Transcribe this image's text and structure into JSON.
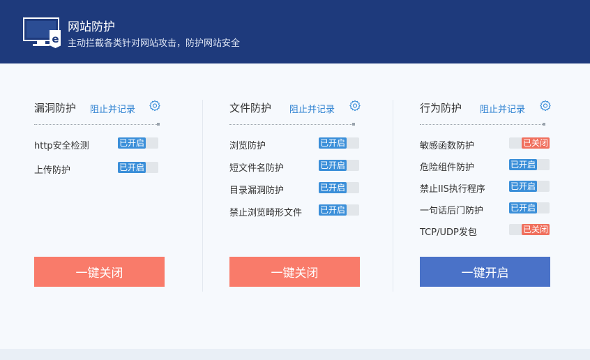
{
  "header": {
    "title": "网站防护",
    "subtitle": "主动拦截各类针对网站攻击，防护网站安全",
    "monitor_badge": "e"
  },
  "colors": {
    "header_bg": "#1e3a7c",
    "on": "#3b8fd9",
    "off": "#f0705e",
    "close_button": "#f97b6a",
    "open_button": "#4a72c8",
    "link": "#2a7fd0"
  },
  "columns": [
    {
      "title": "漏洞防护",
      "action": "阻止并记录",
      "icon": "gear-icon",
      "items": [
        {
          "label": "http安全检测",
          "status": "已开启",
          "state": "on"
        },
        {
          "label": "上传防护",
          "status": "已开启",
          "state": "on"
        }
      ],
      "button": "一键关闭"
    },
    {
      "title": "文件防护",
      "action": "阻止并记录",
      "icon": "gear-icon",
      "items": [
        {
          "label": "浏览防护",
          "status": "已开启",
          "state": "on"
        },
        {
          "label": "短文件名防护",
          "status": "已开启",
          "state": "on"
        },
        {
          "label": "目录漏洞防护",
          "status": "已开启",
          "state": "on"
        },
        {
          "label": "禁止浏览畸形文件",
          "status": "已开启",
          "state": "on"
        }
      ],
      "button": "一键关闭"
    },
    {
      "title": "行为防护",
      "action": "阻止并记录",
      "icon": "gear-icon",
      "items": [
        {
          "label": "敏感函数防护",
          "status": "已关闭",
          "state": "off"
        },
        {
          "label": "危险组件防护",
          "status": "已开启",
          "state": "on"
        },
        {
          "label": "禁止IIS执行程序",
          "status": "已开启",
          "state": "on"
        },
        {
          "label": "一句话后门防护",
          "status": "已开启",
          "state": "on"
        },
        {
          "label": "TCP/UDP发包",
          "status": "已关闭",
          "state": "off"
        }
      ],
      "button": "一键开启"
    }
  ]
}
